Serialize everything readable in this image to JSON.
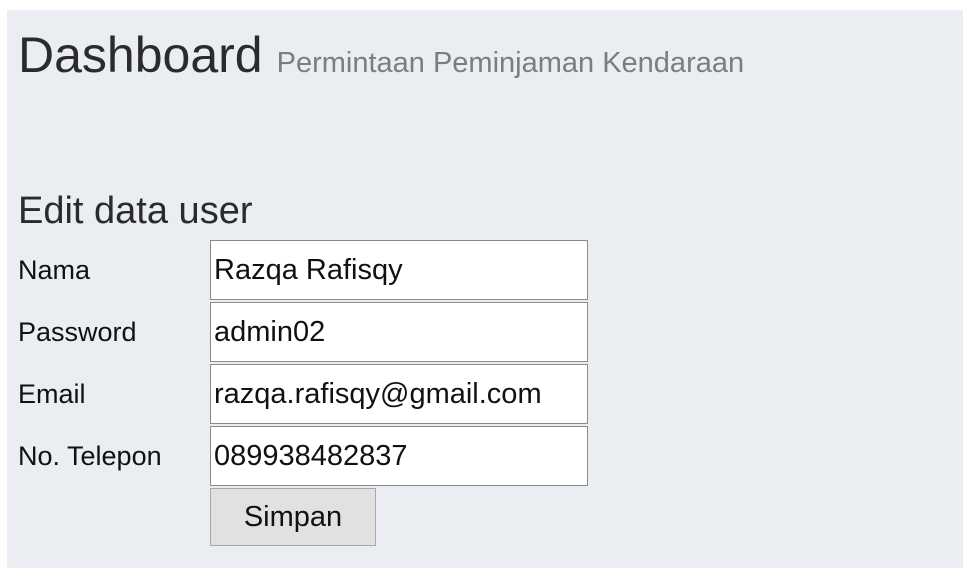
{
  "header": {
    "title": "Dashboard",
    "subtitle": "Permintaan Peminjaman Kendaraan"
  },
  "form": {
    "heading": "Edit data user",
    "fields": [
      {
        "label": "Nama",
        "value": "Razqa Rafisqy"
      },
      {
        "label": "Password",
        "value": "admin02"
      },
      {
        "label": "Email",
        "value": "razqa.rafisqy@gmail.com"
      },
      {
        "label": "No. Telepon",
        "value": "089938482837"
      }
    ],
    "submit_label": "Simpan"
  }
}
